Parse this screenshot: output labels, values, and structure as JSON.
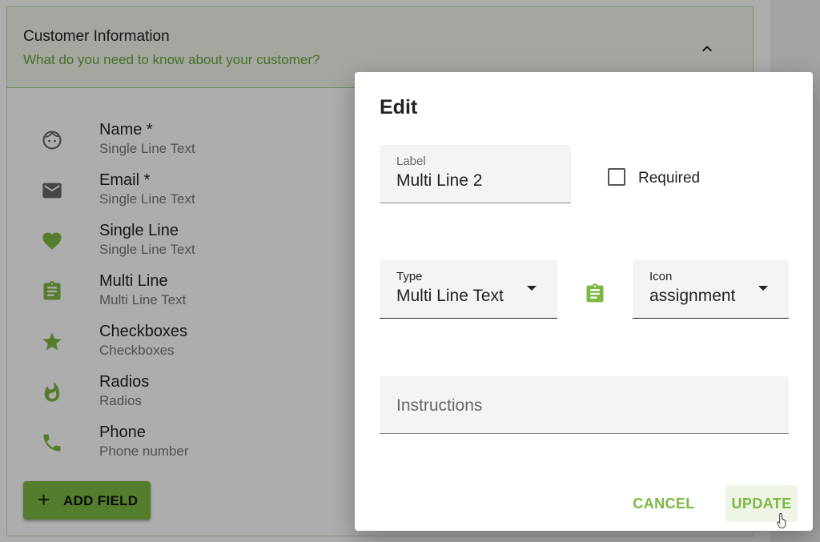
{
  "colors": {
    "accent": "#7cb843",
    "accent_text": "#6aa63d",
    "scrim": "rgba(0,0,0,0.32)"
  },
  "section": {
    "title": "Customer Information",
    "subtitle": "What do you need to know about your customer?",
    "collapse_icon": "chevron-up-icon"
  },
  "fields": [
    {
      "name": "Name *",
      "type": "Single Line Text",
      "icon": "face-icon"
    },
    {
      "name": "Email *",
      "type": "Single Line Text",
      "icon": "email-icon"
    },
    {
      "name": "Single Line",
      "type": "Single Line Text",
      "icon": "heart-icon"
    },
    {
      "name": "Multi Line",
      "type": "Multi Line Text",
      "icon": "assignment-icon"
    },
    {
      "name": "Checkboxes",
      "type": "Checkboxes",
      "icon": "star-icon"
    },
    {
      "name": "Radios",
      "type": "Radios",
      "icon": "whatshot-icon"
    },
    {
      "name": "Phone",
      "type": "Phone number",
      "icon": "phone-icon"
    }
  ],
  "add_field": {
    "plus": "+",
    "label": "ADD FIELD"
  },
  "dialog": {
    "title": "Edit",
    "label_field": {
      "label": "Label",
      "value": "Multi Line 2"
    },
    "required": {
      "label": "Required",
      "checked": false
    },
    "type_select": {
      "label": "Type",
      "value": "Multi Line Text"
    },
    "preview_icon": "assignment-icon",
    "icon_select": {
      "label": "Icon",
      "value": "assignment"
    },
    "instructions": {
      "placeholder": "Instructions",
      "value": ""
    },
    "cancel_label": "CANCEL",
    "update_label": "UPDATE"
  }
}
